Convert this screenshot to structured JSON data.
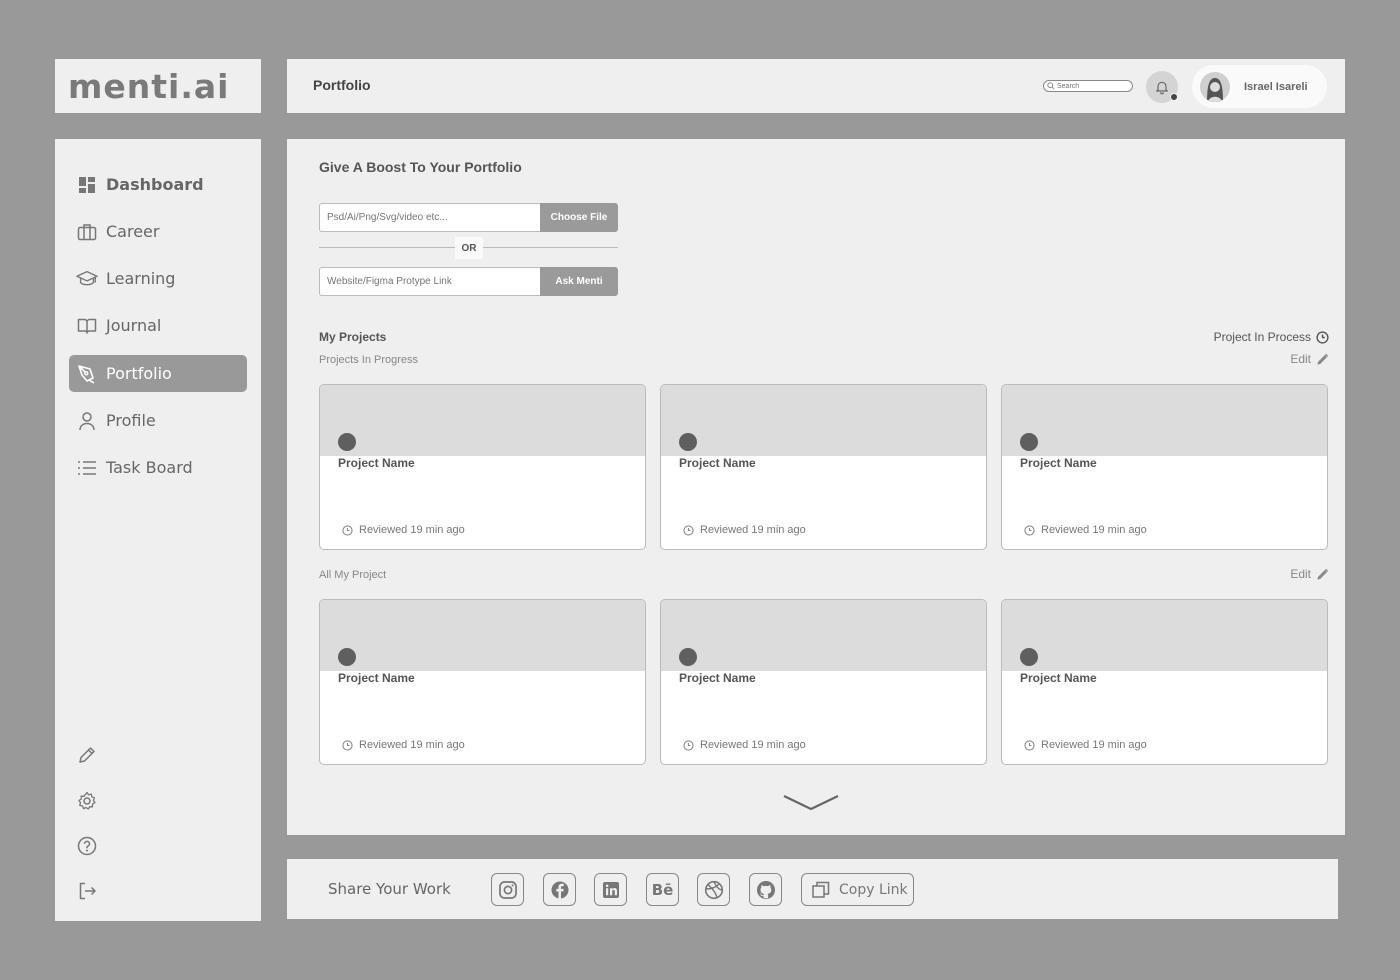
{
  "brand": {
    "logo": "menti.ai"
  },
  "header": {
    "title": "Portfolio",
    "search_placeholder": "Search",
    "user_name": "Israel Isareli"
  },
  "sidebar": {
    "items": [
      {
        "label": "Dashboard",
        "icon": "dashboard-icon"
      },
      {
        "label": "Career",
        "icon": "briefcase-icon"
      },
      {
        "label": "Learning",
        "icon": "graduation-cap-icon"
      },
      {
        "label": "Journal",
        "icon": "book-icon"
      },
      {
        "label": "Portfolio",
        "icon": "pen-nib-icon",
        "active": true
      },
      {
        "label": "Profile",
        "icon": "user-icon"
      },
      {
        "label": "Task Board",
        "icon": "list-icon"
      }
    ],
    "tools": [
      "pencil-icon",
      "gear-icon",
      "help-icon",
      "logout-icon"
    ]
  },
  "boost": {
    "title": "Give A Boost To Your Portfolio",
    "file_placeholder": "Psd/Ai/Png/Svg/video etc...",
    "choose_label": "Choose File",
    "or_label": "OR",
    "link_placeholder": "Website/Figma Protype Link",
    "ask_label": "Ask Menti"
  },
  "projects": {
    "title": "My Projects",
    "process_label": "Project In Process",
    "in_progress_label": "Projects In Progress",
    "all_label": "All My Project",
    "edit_label": "Edit",
    "in_progress": [
      {
        "name": "Project Name",
        "reviewed": "Reviewed 19 min ago"
      },
      {
        "name": "Project Name",
        "reviewed": "Reviewed 19 min ago"
      },
      {
        "name": "Project Name",
        "reviewed": "Reviewed 19 min ago"
      }
    ],
    "all": [
      {
        "name": "Project Name",
        "reviewed": "Reviewed 19 min ago"
      },
      {
        "name": "Project Name",
        "reviewed": "Reviewed 19 min ago"
      },
      {
        "name": "Project Name",
        "reviewed": "Reviewed 19 min ago"
      }
    ]
  },
  "footer": {
    "share_label": "Share Your Work",
    "socials": [
      "instagram-icon",
      "facebook-icon",
      "linkedin-icon",
      "behance-icon",
      "dribbble-icon",
      "github-icon"
    ],
    "copy_label": "Copy Link"
  }
}
